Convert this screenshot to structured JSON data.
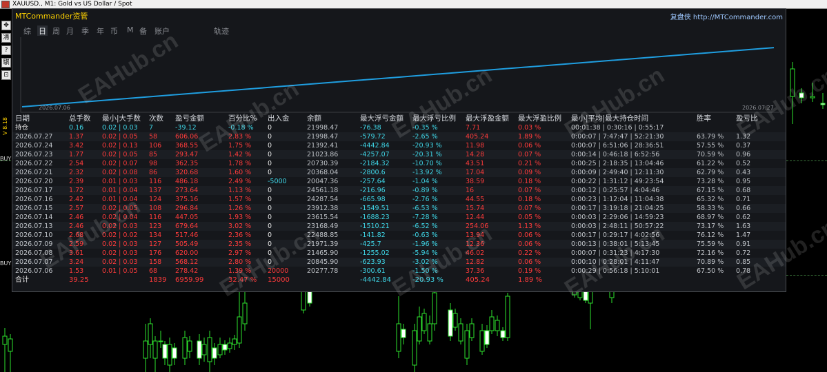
{
  "window_title": "XAUUSD., M1:  Gold vs US Dollar / Spot",
  "left_toolbar": [
    "✥",
    "凊",
    "?",
    "騏",
    "⊡"
  ],
  "side_labels": [
    "V 8.18",
    "BUY",
    "BUY"
  ],
  "watermark_text": "EAHub.cn",
  "panel": {
    "title": "MTCommander资管",
    "brand": "复盘侠 http://MTCommander.com",
    "tabs": [
      "综",
      "日",
      "周",
      "月",
      "季",
      "年",
      "币",
      "M",
      "备",
      "账户",
      "轨迹"
    ],
    "active_tab": "日",
    "curve_start_label": "2026.07.06",
    "curve_end_label": "2026.07.27",
    "curve_color": "#1f9ee0",
    "columns": [
      "日期",
      "总手数",
      "最小|大手数",
      "次数",
      "盈亏金额",
      "百分比%",
      "出入金",
      "余额",
      "最大浮亏金额",
      "最大浮亏比例",
      "最大浮盈金额",
      "最大浮盈比例",
      "最小|平均|最大持仓时间",
      "胜率",
      "盈亏比"
    ],
    "holding": {
      "label": "持仓",
      "lots": "0.16",
      "minmax": "0.02 | 0.03",
      "count": "7",
      "pnl": "-39.12",
      "pct": "-0.18 %",
      "flow": "0",
      "balance": "21998.47",
      "maxloss": "-76.38",
      "maxloss_pct": "-0.35 %",
      "maxprofit": "7.71",
      "maxprofit_pct": "0.03 %",
      "hold": "00:01:38 | 0:30:16 | 0:55:17",
      "win": "",
      "ratio": ""
    },
    "rows": [
      {
        "date": "2026.07.27",
        "lots": "1.37",
        "minmax": "0.02 | 0.05",
        "count": "58",
        "pnl": "606.06",
        "pct": "2.83 %",
        "flow": "0",
        "balance": "21998.47",
        "maxloss": "-579.72",
        "maxloss_pct": "-2.65 %",
        "maxprofit": "405.24",
        "maxprofit_pct": "1.89 %",
        "hold": "0:00:07 | 7:47:47 | 52:21:30",
        "win": "63.79 %",
        "ratio": "1.32"
      },
      {
        "date": "2026.07.24",
        "lots": "3.42",
        "minmax": "0.02 | 0.13",
        "count": "106",
        "pnl": "368.55",
        "pct": "1.75 %",
        "flow": "0",
        "balance": "21392.41",
        "maxloss": "-4442.84",
        "maxloss_pct": "-20.93 %",
        "maxprofit": "11.98",
        "maxprofit_pct": "0.06 %",
        "hold": "0:00:07 | 6:51:06 | 28:36:51",
        "win": "57.55 %",
        "ratio": "0.37"
      },
      {
        "date": "2026.07.23",
        "lots": "1.77",
        "minmax": "0.02 | 0.05",
        "count": "85",
        "pnl": "293.47",
        "pct": "1.42 %",
        "flow": "0",
        "balance": "21023.86",
        "maxloss": "-4257.07",
        "maxloss_pct": "-20.31 %",
        "maxprofit": "14.28",
        "maxprofit_pct": "0.07 %",
        "hold": "0:00:14 | 0:46:18 | 6:52:56",
        "win": "70.59 %",
        "ratio": "0.96"
      },
      {
        "date": "2026.07.22",
        "lots": "2.54",
        "minmax": "0.02 | 0.07",
        "count": "98",
        "pnl": "362.35",
        "pct": "1.78 %",
        "flow": "0",
        "balance": "20730.39",
        "maxloss": "-2184.32",
        "maxloss_pct": "-10.70 %",
        "maxprofit": "43.51",
        "maxprofit_pct": "0.21 %",
        "hold": "0:00:25 | 2:18:35 | 13:04:46",
        "win": "61.22 %",
        "ratio": "0.52"
      },
      {
        "date": "2026.07.21",
        "lots": "2.32",
        "minmax": "0.02 | 0.08",
        "count": "86",
        "pnl": "320.68",
        "pct": "1.60 %",
        "flow": "0",
        "balance": "20368.04",
        "maxloss": "-2800.6",
        "maxloss_pct": "-13.92 %",
        "maxprofit": "17.04",
        "maxprofit_pct": "0.09 %",
        "hold": "0:00:09 | 2:49:40 | 12:11:30",
        "win": "62.79 %",
        "ratio": "0.43"
      },
      {
        "date": "2026.07.20",
        "lots": "2.39",
        "minmax": "0.01 | 0.03",
        "count": "116",
        "pnl": "486.18",
        "pct": "2.49 %",
        "flow": "-5000",
        "balance": "20047.36",
        "maxloss": "-257.64",
        "maxloss_pct": "-1.04 %",
        "maxprofit": "38.59",
        "maxprofit_pct": "0.18 %",
        "hold": "0:00:22 | 1:31:12 | 49:23:54",
        "win": "73.28 %",
        "ratio": "0.95"
      },
      {
        "date": "2026.07.17",
        "lots": "1.72",
        "minmax": "0.01 | 0.04",
        "count": "137",
        "pnl": "273.64",
        "pct": "1.13 %",
        "flow": "0",
        "balance": "24561.18",
        "maxloss": "-216.96",
        "maxloss_pct": "-0.89 %",
        "maxprofit": "16",
        "maxprofit_pct": "0.07 %",
        "hold": "0:00:12 | 0:25:57 | 4:04:46",
        "win": "67.15 %",
        "ratio": "0.68"
      },
      {
        "date": "2026.07.16",
        "lots": "2.42",
        "minmax": "0.01 | 0.04",
        "count": "124",
        "pnl": "375.16",
        "pct": "1.57 %",
        "flow": "0",
        "balance": "24287.54",
        "maxloss": "-665.98",
        "maxloss_pct": "-2.76 %",
        "maxprofit": "44.55",
        "maxprofit_pct": "0.18 %",
        "hold": "0:00:23 | 1:12:04 | 11:04:38",
        "win": "65.32 %",
        "ratio": "0.71"
      },
      {
        "date": "2026.07.15",
        "lots": "2.57",
        "minmax": "0.02 | 0.05",
        "count": "108",
        "pnl": "296.84",
        "pct": "1.26 %",
        "flow": "0",
        "balance": "23912.38",
        "maxloss": "-1549.51",
        "maxloss_pct": "-6.53 %",
        "maxprofit": "15.74",
        "maxprofit_pct": "0.07 %",
        "hold": "0:00:17 | 3:19:18 | 21:04:25",
        "win": "58.33 %",
        "ratio": "0.66"
      },
      {
        "date": "2026.07.14",
        "lots": "2.46",
        "minmax": "0.02 | 0.04",
        "count": "116",
        "pnl": "447.05",
        "pct": "1.93 %",
        "flow": "0",
        "balance": "23615.54",
        "maxloss": "-1688.23",
        "maxloss_pct": "-7.28 %",
        "maxprofit": "12.44",
        "maxprofit_pct": "0.05 %",
        "hold": "0:00:03 | 2:29:06 | 14:59:23",
        "win": "68.97 %",
        "ratio": "0.62"
      },
      {
        "date": "2026.07.13",
        "lots": "2.46",
        "minmax": "0.02 | 0.03",
        "count": "123",
        "pnl": "679.64",
        "pct": "3.02 %",
        "flow": "0",
        "balance": "23168.49",
        "maxloss": "-1510.21",
        "maxloss_pct": "-6.52 %",
        "maxprofit": "254.06",
        "maxprofit_pct": "1.13 %",
        "hold": "0:00:03 | 2:48:11 | 50:57:22",
        "win": "73.17 %",
        "ratio": "1.63"
      },
      {
        "date": "2026.07.10",
        "lots": "2.68",
        "minmax": "0.02 | 0.02",
        "count": "134",
        "pnl": "517.46",
        "pct": "2.36 %",
        "flow": "0",
        "balance": "22488.85",
        "maxloss": "-141.82",
        "maxloss_pct": "-0.63 %",
        "maxprofit": "13.94",
        "maxprofit_pct": "0.06 %",
        "hold": "0:00:17 | 0:29:17 | 4:02:56",
        "win": "76.12 %",
        "ratio": "1.47"
      },
      {
        "date": "2026.07.09",
        "lots": "2.59",
        "minmax": "0.02 | 0.03",
        "count": "127",
        "pnl": "505.49",
        "pct": "2.35 %",
        "flow": "0",
        "balance": "21971.39",
        "maxloss": "-425.7",
        "maxloss_pct": "-1.96 %",
        "maxprofit": "12.36",
        "maxprofit_pct": "0.06 %",
        "hold": "0:00:13 | 0:38:01 | 5:13:45",
        "win": "75.59 %",
        "ratio": "0.91"
      },
      {
        "date": "2026.07.08",
        "lots": "3.61",
        "minmax": "0.02 | 0.03",
        "count": "176",
        "pnl": "620.00",
        "pct": "2.97 %",
        "flow": "0",
        "balance": "21465.90",
        "maxloss": "-1255.02",
        "maxloss_pct": "-5.94 %",
        "maxprofit": "46.02",
        "maxprofit_pct": "0.22 %",
        "hold": "0:00:07 | 0:31:23 | 4:17:30",
        "win": "72.16 %",
        "ratio": "0.72"
      },
      {
        "date": "2026.07.07",
        "lots": "3.24",
        "minmax": "0.02 | 0.03",
        "count": "158",
        "pnl": "568.12",
        "pct": "2.80 %",
        "flow": "0",
        "balance": "20845.90",
        "maxloss": "-623.93",
        "maxloss_pct": "-3.02 %",
        "maxprofit": "12.82",
        "maxprofit_pct": "0.06 %",
        "hold": "0:00:10 | 0:28:01 | 4:11:47",
        "win": "70.89 %",
        "ratio": "0.85"
      },
      {
        "date": "2026.07.06",
        "lots": "1.53",
        "minmax": "0.01 | 0.05",
        "count": "68",
        "pnl": "278.42",
        "pct": "1.39 %",
        "flow": "20000",
        "balance": "20277.78",
        "maxloss": "-300.61",
        "maxloss_pct": "-1.50 %",
        "maxprofit": "37.36",
        "maxprofit_pct": "0.19 %",
        "hold": "0:00:29 | 0:56:18 | 5:10:01",
        "win": "67.50 %",
        "ratio": "0.78"
      }
    ],
    "total": {
      "label": "合计",
      "lots": "39.25",
      "count": "1839",
      "pnl": "6959.99",
      "pct": "32.47 %",
      "flow": "15000",
      "maxloss": "-4442.84",
      "maxloss_pct": "-20.93 %",
      "maxprofit": "405.24",
      "maxprofit_pct": "1.89 %"
    }
  }
}
